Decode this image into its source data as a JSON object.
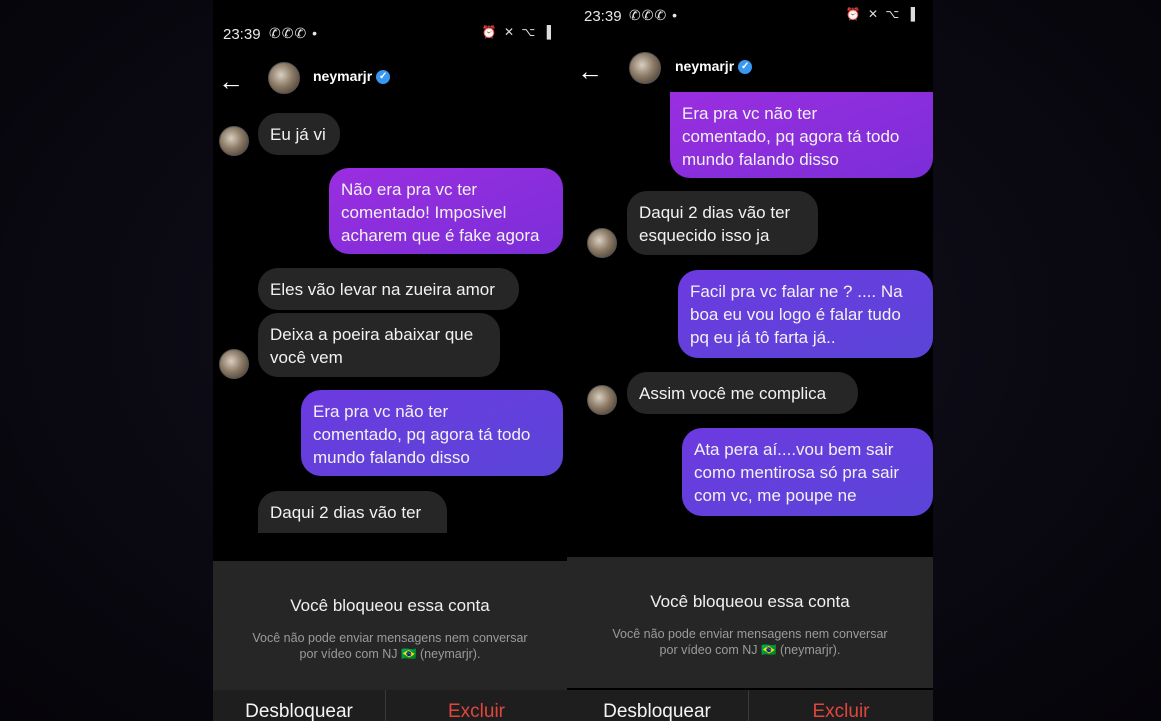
{
  "status": {
    "time": "23:39",
    "wa": "✆✆✆ •",
    "sys": "⏰ ✕ ⌥ ▐"
  },
  "header": {
    "username": "neymarjr",
    "verified": "✓"
  },
  "messages_left": [
    "Eu já vi",
    "Não era pra vc ter\ncomentado! Imposivel\nacharem que é fake agora",
    "Eles vão levar na zueira amor",
    "Deixa a poeira abaixar que\nvocê vem",
    "Era pra vc não ter\ncomentado, pq agora tá todo\nmundo falando disso",
    "Daqui 2 dias vão ter"
  ],
  "messages_right": [
    "Era pra vc não ter\ncomentado, pq agora tá todo\nmundo falando disso",
    "Daqui 2 dias vão ter\nesquecido isso ja",
    "Facil pra vc falar ne ? .... Na\nboa eu vou logo é falar tudo\npq eu já tô farta já..",
    "Assim você me complica",
    "Ata pera aí....vou bem sair\ncomo mentirosa só pra sair\ncom vc, me poupe ne"
  ],
  "blocked": {
    "title": "Você bloqueou essa conta",
    "desc": "Você não pode enviar mensagens nem conversar\npor vídeo com NJ 🇧🇷 (neymarjr)."
  },
  "actions": {
    "unblock": "Desbloquear",
    "delete": "Excluir"
  }
}
